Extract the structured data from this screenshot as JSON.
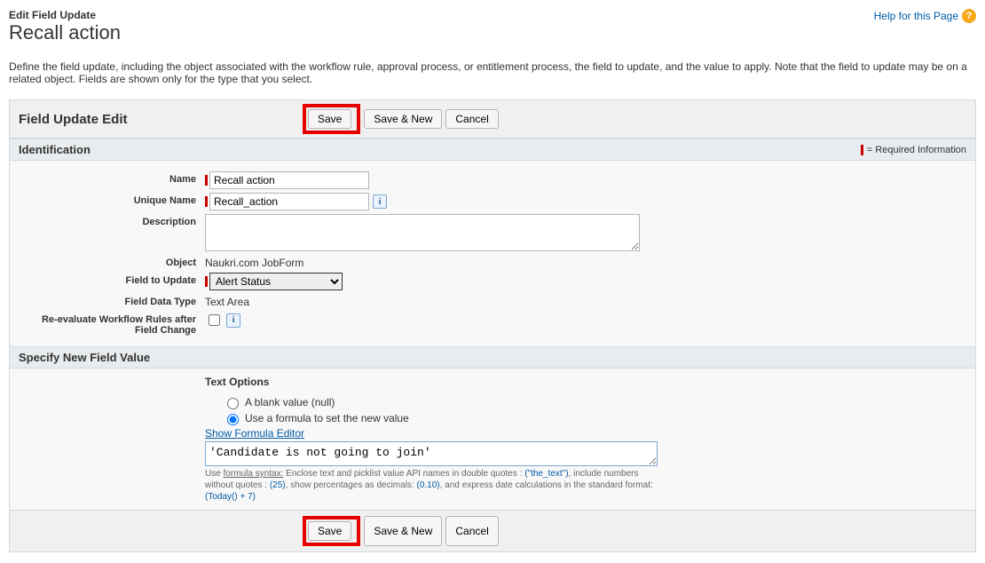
{
  "header": {
    "subtitle": "Edit Field Update",
    "title": "Recall action",
    "help_label": "Help for this Page"
  },
  "intro": "Define the field update, including the object associated with the workflow rule, approval process, or entitlement process, the field to update, and the value to apply. Note that the field to update may be on a related object. Fields are shown only for the type that you select.",
  "panel": {
    "title": "Field Update Edit",
    "btn_save": "Save",
    "btn_save_new": "Save & New",
    "btn_cancel": "Cancel"
  },
  "sections": {
    "identification": "Identification",
    "specify": "Specify New Field Value",
    "required_info": "= Required Information"
  },
  "labels": {
    "name": "Name",
    "unique_name": "Unique Name",
    "description": "Description",
    "object": "Object",
    "field_to_update": "Field to Update",
    "field_data_type": "Field Data Type",
    "reeval": "Re-evaluate Workflow Rules after Field Change"
  },
  "values": {
    "name": "Recall action",
    "unique_name": "Recall_action",
    "description": "",
    "object": "Naukri.com JobForm",
    "field_to_update": "Alert Status",
    "field_data_type": "Text Area"
  },
  "text_options": {
    "title": "Text Options",
    "blank": "A blank value (null)",
    "formula": "Use a formula to set the new value",
    "show_editor": "Show Formula Editor",
    "formula_value": "'Candidate is not going to join'",
    "help_prefix": "Use ",
    "help_syntax": "formula syntax:",
    "help_body": " Enclose text and picklist value API names in double quotes : ",
    "help_ex1": "(\"the_text\")",
    "help_body2": ", include numbers without quotes : ",
    "help_ex2": "(25)",
    "help_body3": ", show percentages as decimals: ",
    "help_ex3": "(0.10)",
    "help_body4": ", and express date calculations in the standard format: ",
    "help_ex4": "(Today() + 7)"
  }
}
